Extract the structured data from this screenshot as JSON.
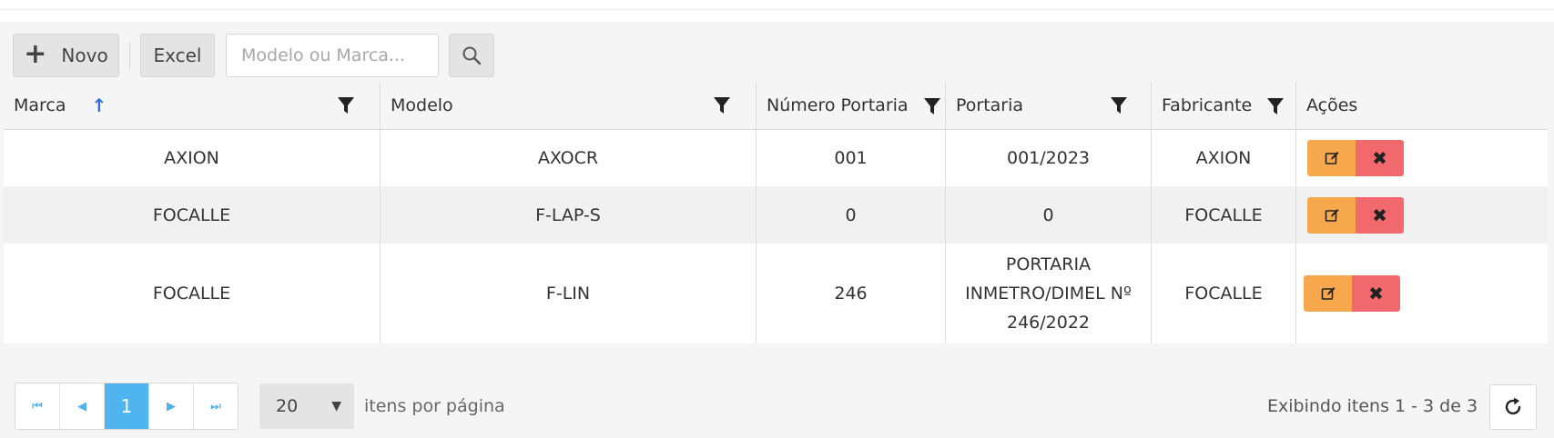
{
  "toolbar": {
    "new_label": "Novo",
    "excel_label": "Excel",
    "search_placeholder": "Modelo ou Marca...",
    "search_value": ""
  },
  "columns": [
    {
      "label": "Marca",
      "sorted": "asc",
      "filterable": true
    },
    {
      "label": "Modelo",
      "filterable": true
    },
    {
      "label": "Número Portaria",
      "filterable": true
    },
    {
      "label": "Portaria",
      "filterable": true
    },
    {
      "label": "Fabricante",
      "filterable": true
    },
    {
      "label": "Ações",
      "filterable": false
    }
  ],
  "rows": [
    {
      "marca": "AXION",
      "modelo": "AXOCR",
      "numero_portaria": "001",
      "portaria": "001/2023",
      "fabricante": "AXION"
    },
    {
      "marca": "FOCALLE",
      "modelo": "F-LAP-S",
      "numero_portaria": "0",
      "portaria": "0",
      "fabricante": "FOCALLE"
    },
    {
      "marca": "FOCALLE",
      "modelo": "F-LIN",
      "numero_portaria": "246",
      "portaria": "PORTARIA INMETRO/DIMEL Nº 246/2022",
      "fabricante": "FOCALLE"
    }
  ],
  "pagination": {
    "current_page": "1",
    "page_size": "20",
    "page_size_label": "itens por página",
    "info": "Exibindo itens 1 - 3 de 3"
  },
  "icons": {
    "new": "plus-icon",
    "search": "search-icon",
    "sort": "arrow-up-icon",
    "filter": "filter-icon",
    "edit": "edit-icon",
    "delete": "close-icon",
    "first": "first-page-icon",
    "prev": "prev-page-icon",
    "next": "next-page-icon",
    "last": "last-page-icon",
    "refresh": "refresh-icon"
  },
  "colors": {
    "edit_button": "#f8a84c",
    "delete_button": "#f2696d",
    "active_page": "#4fb4f0",
    "sort_arrow": "#2f6fe0"
  }
}
